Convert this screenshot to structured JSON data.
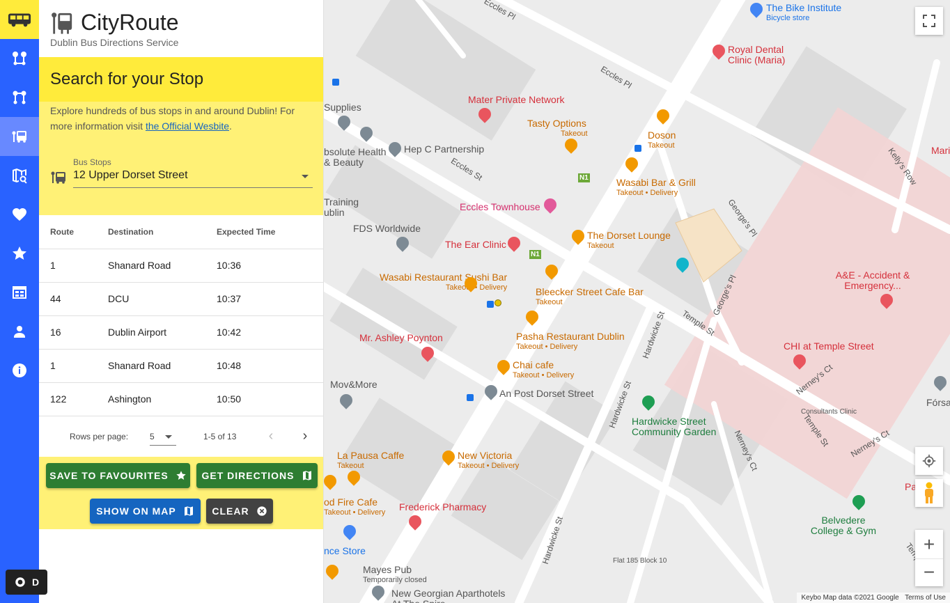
{
  "brand": {
    "name": "CityRoute",
    "subtitle": "Dublin Bus Directions Service"
  },
  "nav": {
    "items": [
      "route-pair-icon",
      "route-pair-alt-icon",
      "bus-stop-icon",
      "map-search-icon",
      "heart-icon",
      "star-icon",
      "calendar-icon",
      "person-icon",
      "info-icon"
    ],
    "active_index": 2,
    "theme_toggle_label": "D"
  },
  "search": {
    "heading": "Search for your Stop",
    "description": "Explore hundreds of bus stops in and around Dublin! For more information visit ",
    "link_text": "the Official Wesbite",
    "description_end": ".",
    "field_label": "Bus Stops",
    "selected_stop": "12 Upper Dorset Street"
  },
  "table": {
    "headers": [
      "Route",
      "Destination",
      "Expected Time"
    ],
    "rows": [
      {
        "route": "1",
        "destination": "Shanard Road",
        "time": "10:36"
      },
      {
        "route": "44",
        "destination": "DCU",
        "time": "10:37"
      },
      {
        "route": "16",
        "destination": "Dublin Airport",
        "time": "10:42"
      },
      {
        "route": "1",
        "destination": "Shanard Road",
        "time": "10:48"
      },
      {
        "route": "122",
        "destination": "Ashington",
        "time": "10:50"
      }
    ],
    "rows_per_page_label": "Rows per page:",
    "rows_per_page": "5",
    "range": "1-5 of 13"
  },
  "actions": {
    "save": "SAVE TO FAVOURITES",
    "directions": "GET DIRECTIONS",
    "show_map": "SHOW ON MAP",
    "clear": "CLEAR"
  },
  "map": {
    "pois": [
      {
        "name": "The Bike Institute",
        "sub": "Bicycle store",
        "color": "blue"
      },
      {
        "name": "Royal Dental Clinic (Maria)",
        "color": "red"
      },
      {
        "name": "Mater Private Network",
        "color": "red"
      },
      {
        "name": "Tasty Options",
        "sub": "Takeout",
        "color": "orange"
      },
      {
        "name": "Doson",
        "sub": "Takeout",
        "color": "orange"
      },
      {
        "name": "Wasabi Bar & Grill",
        "sub": "Takeout • Delivery",
        "color": "orange"
      },
      {
        "name": "Hep C Partnership",
        "color": "grey"
      },
      {
        "name": "Eccles Townhouse",
        "color": "pink"
      },
      {
        "name": "The Dorset Lounge",
        "sub": "Takeout",
        "color": "orange"
      },
      {
        "name": "FDS Worldwide",
        "color": "grey"
      },
      {
        "name": "The Ear Clinic",
        "color": "red"
      },
      {
        "name": "Wasabi Restaurant Sushi Bar",
        "sub": "Takeout • Delivery",
        "color": "orange"
      },
      {
        "name": "Bleecker Street Cafe Bar",
        "sub": "Takeout",
        "color": "orange"
      },
      {
        "name": "Mr. Ashley Poynton",
        "color": "red"
      },
      {
        "name": "Pasha Restaurant Dublin",
        "sub": "Takeout • Delivery",
        "color": "orange"
      },
      {
        "name": "Chai cafe",
        "sub": "Takeout • Delivery",
        "color": "orange"
      },
      {
        "name": "An Post Dorset Street",
        "color": "grey"
      },
      {
        "name": "Mov&More",
        "color": "grey"
      },
      {
        "name": "Hardwicke Street Community Garden",
        "color": "green"
      },
      {
        "name": "La Pausa Caffe",
        "sub": "Takeout",
        "color": "orange"
      },
      {
        "name": "New Victoria",
        "sub": "Takeout • Delivery",
        "color": "orange"
      },
      {
        "name": "Frederick Pharmacy",
        "color": "red"
      },
      {
        "name": "A&E - Accident & Emergency...",
        "color": "red"
      },
      {
        "name": "CHI at Temple Street",
        "color": "red"
      },
      {
        "name": "Belvedere College & Gym",
        "color": "green"
      },
      {
        "name": "Mayes Pub",
        "sub": "Temporarily closed",
        "color": "grey"
      },
      {
        "name": "New Georgian Aparthotels At The Spire",
        "color": "grey"
      },
      {
        "name": "Supplies",
        "color": "grey"
      },
      {
        "name": "bsolute Health & Beauty",
        "color": "grey"
      },
      {
        "name": "Training ublin",
        "color": "grey"
      },
      {
        "name": "od Fire Cafe",
        "sub": "Takeout • Delivery",
        "color": "orange"
      },
      {
        "name": "nce Store",
        "color": "blue"
      },
      {
        "name": "Consultants Clinic",
        "color": "grey"
      },
      {
        "name": "Fórsa",
        "color": "grey"
      },
      {
        "name": "Flat 185 Block 10",
        "color": "grey"
      },
      {
        "name": "Mari",
        "color": "red"
      },
      {
        "name": "Pa",
        "color": "red"
      }
    ],
    "streets": [
      "Eccles Pl",
      "Eccles Pl",
      "Eccles St",
      "Kelly's Row",
      "George's Pl",
      "George's Pl",
      "Temple St",
      "Hardwicke St",
      "Hardwicke St",
      "Hardwicke St",
      "Nerney's Ct",
      "Nerney's Ct",
      "Nerney's Ct",
      "Temple St",
      "Temple"
    ],
    "route_badge": "N1",
    "attribution": {
      "keybo": "Keybo",
      "data": "Map data ©2021 Google",
      "terms": "Terms of Use"
    }
  }
}
